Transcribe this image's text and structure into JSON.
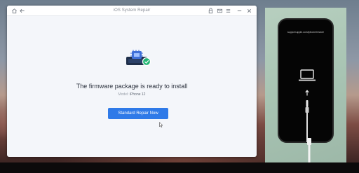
{
  "window": {
    "title": "iOS System Repair"
  },
  "main": {
    "headline": "The firmware package is ready to install",
    "model_label": "Model:",
    "model_value": "iPhone 12",
    "primary_button": "Standard Repair Now"
  },
  "phone_screen": {
    "url": "support.apple.com/iphone/restore"
  },
  "colors": {
    "accent": "#2f7ae8",
    "success": "#22b573",
    "window_bg": "#f4f6fa",
    "panel_green": "#a8c4b3"
  },
  "icons": {
    "titlebar_left": [
      "home-icon",
      "back-icon"
    ],
    "titlebar_right": [
      "account-icon",
      "mail-icon",
      "menu-icon",
      "minimize-icon",
      "close-icon"
    ],
    "illustration": [
      "phone-chip-icon",
      "checkmark-icon"
    ],
    "phone": [
      "laptop-icon",
      "arrow-up-icon",
      "lightning-cable-icon"
    ]
  }
}
